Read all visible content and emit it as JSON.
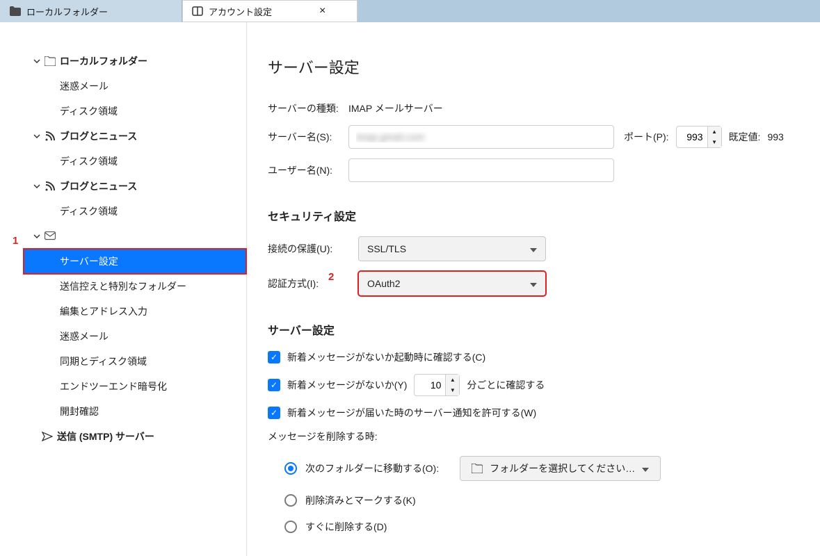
{
  "tabs": {
    "inactive": "ローカルフォルダー",
    "active": "アカウント設定"
  },
  "sidebar": {
    "local_folders": "ローカルフォルダー",
    "junk": "迷惑メール",
    "disk": "ディスク領域",
    "blog1": "ブログとニュース",
    "blog2": "ブログとニュース",
    "account": "　",
    "server_settings": "サーバー設定",
    "copies": "送信控えと特別なフォルダー",
    "compose": "編集とアドレス入力",
    "junk2": "迷惑メール",
    "sync": "同期とディスク領域",
    "e2e": "エンドツーエンド暗号化",
    "receipt": "開封確認",
    "smtp": "送信 (SMTP) サーバー"
  },
  "badges": {
    "one": "1",
    "two": "2"
  },
  "page": {
    "title": "サーバー設定",
    "server_type_label": "サーバーの種類:",
    "server_type_value": "IMAP メールサーバー",
    "server_name_label": "サーバー名(S):",
    "server_name_value": "imap.gmail.com",
    "port_label": "ポート(P):",
    "port_value": "993",
    "default_port_label": "既定値:",
    "default_port_value": "993",
    "username_label": "ユーザー名(N):",
    "username_value": "　"
  },
  "security": {
    "heading": "セキュリティ設定",
    "conn_label": "接続の保護(U):",
    "conn_value": "SSL/TLS",
    "auth_label": "認証方式(I):",
    "auth_value": "OAuth2"
  },
  "server": {
    "heading": "サーバー設定",
    "check_startup": "新着メッセージがないか起動時に確認する(C)",
    "check_interval_prefix": "新着メッセージがないか(Y)",
    "check_interval_value": "10",
    "check_interval_suffix": "分ごとに確認する",
    "allow_notify": "新着メッセージが届いた時のサーバー通知を許可する(W)",
    "delete_heading": "メッセージを削除する時:",
    "radio_move": "次のフォルダーに移動する(O):",
    "folder_btn": "フォルダーを選択してください…",
    "radio_mark": "削除済みとマークする(K)",
    "radio_now": "すぐに削除する(D)"
  }
}
